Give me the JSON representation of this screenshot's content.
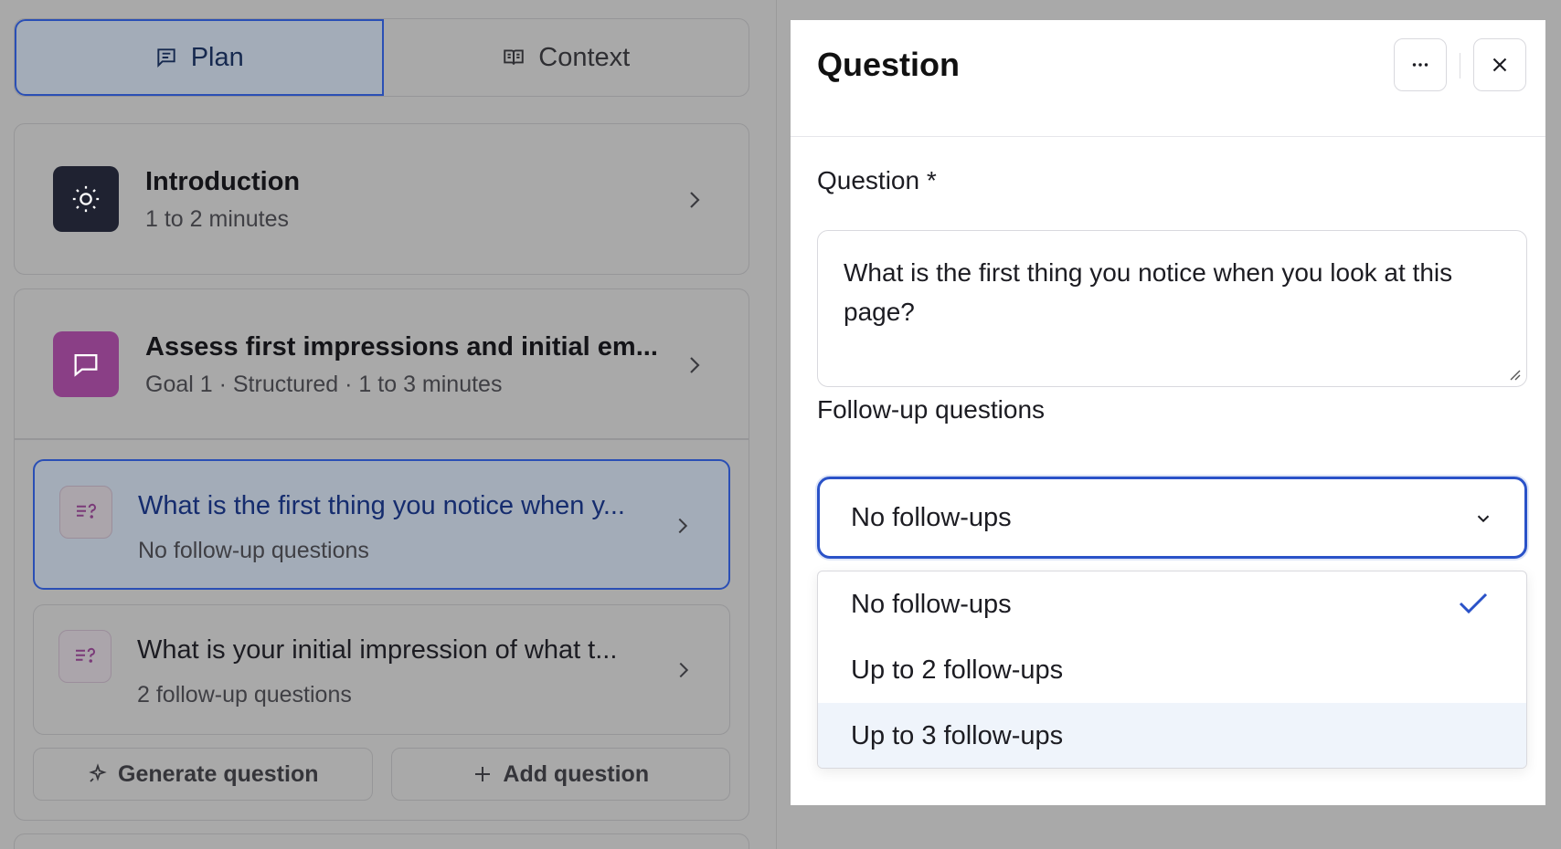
{
  "tabs": [
    {
      "label": "Plan",
      "icon": "message-lines-icon",
      "active": true
    },
    {
      "label": "Context",
      "icon": "book-open-icon",
      "active": false
    }
  ],
  "intro": {
    "title": "Introduction",
    "subtitle": "1 to 2 minutes",
    "icon": "sun-icon"
  },
  "goal": {
    "title": "Assess first impressions and initial em...",
    "subtitle": "Goal 1 · Structured · 1 to 3 minutes",
    "icon": "chat-bubble-icon",
    "questions": [
      {
        "title": "What is the first thing you notice when y...",
        "subtitle": "No follow-up questions",
        "selected": true
      },
      {
        "title": "What is your initial impression of what t...",
        "subtitle": "2 follow-up questions",
        "selected": false
      }
    ],
    "generate_label": "Generate question",
    "add_label": "Add question"
  },
  "drawer": {
    "title": "Question",
    "question_label": "Question *",
    "question_value": "What is the first thing you notice when you look at this page?",
    "followup_label": "Follow-up questions",
    "followup_selected": "No follow-ups",
    "options": [
      "No follow-ups",
      "Up to 2 follow-ups",
      "Up to 3 follow-ups"
    ]
  },
  "colors": {
    "accent": "#2a52c8",
    "purple": "#8a3f86",
    "dark_icon": "#1f2231"
  }
}
